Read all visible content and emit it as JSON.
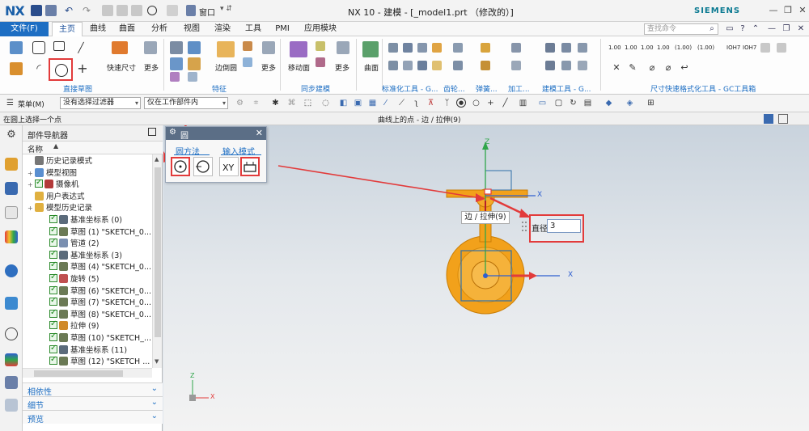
{
  "app": {
    "logo": "NX",
    "window_title": "NX 10 - 建模 - [_model1.prt （修改的）]",
    "brand": "SIEMENS",
    "quick_access": {
      "window_menu_label": "窗口"
    }
  },
  "menu": {
    "file": "文件(F)",
    "tabs": [
      "主页",
      "曲线",
      "曲面",
      "分析",
      "视图",
      "渲染",
      "工具",
      "PMI",
      "应用模块"
    ],
    "active_tab": "主页",
    "search_placeholder": "查找命令"
  },
  "ribbon": {
    "groups": [
      "直接草图",
      "特征",
      "同步建模",
      "标准化工具 - G...",
      "齿轮...",
      "弹簧...",
      "加工...",
      "建模工具 - G...",
      "尺寸快速格式化工具 - GC工具箱"
    ],
    "big_buttons": {
      "rapid_dimension": "快速尺寸",
      "more_1": "更多",
      "edge_blend": "边倒圆",
      "more_2": "更多",
      "move_face": "移动面",
      "more_3": "更多",
      "surface": "曲面"
    },
    "dim_tools": [
      "1.00",
      "1.00",
      "1.00",
      "1.00",
      "(1.00)",
      "(1.00)",
      "IOH7",
      "IOH7"
    ]
  },
  "selection_bar": {
    "menu_button": "菜单(M)",
    "type_filter": "没有选择过滤器",
    "scope": "仅在工作部件内"
  },
  "status": {
    "prompt": "在圆上选择一个点",
    "selection_info": "曲线上的点 - 边 / 拉伸(9)"
  },
  "navigator": {
    "title": "部件导航器",
    "column_name": "名称",
    "rows": [
      {
        "label": "历史记录模式",
        "indent": 0,
        "checked": false,
        "icon": "clock-icon",
        "color": "#777777"
      },
      {
        "label": "模型视图",
        "indent": 0,
        "checked": false,
        "icon": "model-view-icon",
        "color": "#5a8fd0",
        "expand": true
      },
      {
        "label": "摄像机",
        "indent": 0,
        "checked": true,
        "icon": "camera-icon",
        "color": "#b33a3a",
        "expand": true
      },
      {
        "label": "用户表达式",
        "indent": 0,
        "checked": false,
        "icon": "folder-icon",
        "color": "#e0b040"
      },
      {
        "label": "模型历史记录",
        "indent": 0,
        "checked": false,
        "icon": "folder-icon",
        "color": "#e0b040",
        "expand": true
      },
      {
        "label": "基准坐标系 (0)",
        "indent": 1,
        "checked": true,
        "icon": "datum-csys-icon",
        "color": "#5b6b7b"
      },
      {
        "label": "草图 (1) \"SKETCH_0...",
        "indent": 1,
        "checked": true,
        "icon": "sketch-icon",
        "color": "#6b7a55"
      },
      {
        "label": "管道 (2)",
        "indent": 1,
        "checked": true,
        "icon": "tube-icon",
        "color": "#7a8fb0"
      },
      {
        "label": "基准坐标系 (3)",
        "indent": 1,
        "checked": true,
        "icon": "datum-csys-icon",
        "color": "#5b6b7b"
      },
      {
        "label": "草图 (4) \"SKETCH_0...",
        "indent": 1,
        "checked": true,
        "icon": "sketch-icon",
        "color": "#6b7a55"
      },
      {
        "label": "旋转 (5)",
        "indent": 1,
        "checked": true,
        "icon": "revolve-icon",
        "color": "#c05050"
      },
      {
        "label": "草图 (6) \"SKETCH_0...",
        "indent": 1,
        "checked": true,
        "icon": "sketch-icon",
        "color": "#6b7a55"
      },
      {
        "label": "草图 (7) \"SKETCH_0...",
        "indent": 1,
        "checked": true,
        "icon": "sketch-icon",
        "color": "#6b7a55"
      },
      {
        "label": "草图 (8) \"SKETCH_0...",
        "indent": 1,
        "checked": true,
        "icon": "sketch-icon",
        "color": "#6b7a55"
      },
      {
        "label": "拉伸 (9)",
        "indent": 1,
        "checked": true,
        "icon": "extrude-icon",
        "color": "#d08a2a"
      },
      {
        "label": "草图 (10) \"SKETCH_...",
        "indent": 1,
        "checked": true,
        "icon": "sketch-icon",
        "color": "#6b7a55"
      },
      {
        "label": "基准坐标系 (11)",
        "indent": 1,
        "checked": true,
        "icon": "datum-csys-icon",
        "color": "#5b6b7b"
      },
      {
        "label": "草图 (12) \"SKETCH ...",
        "indent": 1,
        "checked": true,
        "icon": "sketch-icon",
        "color": "#6b7a55"
      }
    ],
    "panels": [
      "相依性",
      "细节",
      "预览"
    ]
  },
  "dialog": {
    "title": "圆",
    "section_method": "圆方法",
    "section_input": "输入模式"
  },
  "graphics": {
    "edge_tooltip": "边 / 拉伸(9)",
    "diameter_label": "直径",
    "diameter_value": "3",
    "axis_labels": {
      "x": "X",
      "y": "Y",
      "z": "Z"
    }
  },
  "colors": {
    "accent": "#1d6ec3",
    "highlight": "#e23b3b",
    "part_orange": "#f2a11b",
    "csys_green": "#2fa64a",
    "csys_blue": "#2f5fd0"
  }
}
